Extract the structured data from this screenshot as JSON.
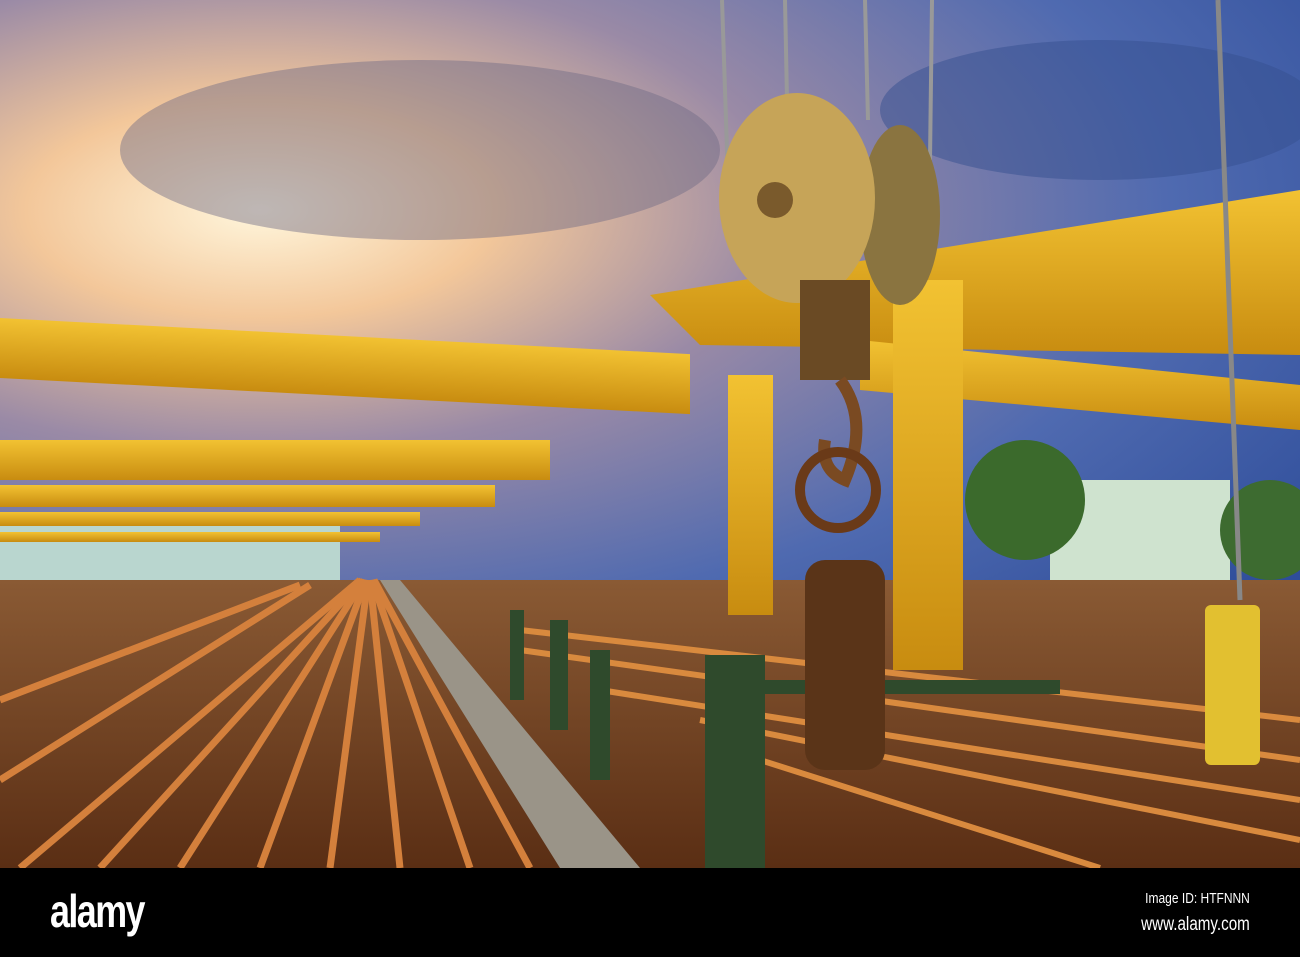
{
  "scene": {
    "description_colors": {
      "sky_top": "#3f5fa8",
      "sky_glow": "#fff4d8",
      "crane_yellow": "#e8b21e",
      "rails": "#b8622a",
      "green_frame": "#2f4a2c"
    }
  },
  "footer": {
    "logo": "alamy",
    "image_id": "Image ID: HTFNNN",
    "url": "www.alamy.com"
  }
}
